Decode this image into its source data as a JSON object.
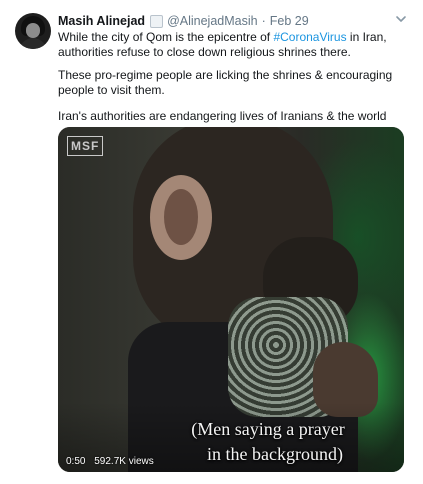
{
  "tweet": {
    "display_name": "Masih Alinejad",
    "handle": "@AlinejadMasih",
    "separator": "·",
    "date": "Feb 29",
    "line1a": "While the city of Qom is the epicentre of ",
    "hashtag": "#CoronaVirus",
    "line1b": " in Iran,",
    "line2": "authorities refuse to close down religious shrines there.",
    "para2": "These pro-regime people are licking the shrines & encouraging people to visit them.",
    "para3": "Iran's authorities are endangering lives of Iranians & the world"
  },
  "media": {
    "logo": "MSF",
    "caption_line1": "(Men saying a prayer",
    "caption_line2": "in the background)",
    "time": "0:50",
    "views": "592.7K views"
  },
  "icons": {
    "verified": "verified-badge-icon",
    "menu": "chevron-down-icon"
  },
  "colors": {
    "link": "#1b95e0",
    "secondary_text": "#657786",
    "primary_text": "#14171a"
  }
}
